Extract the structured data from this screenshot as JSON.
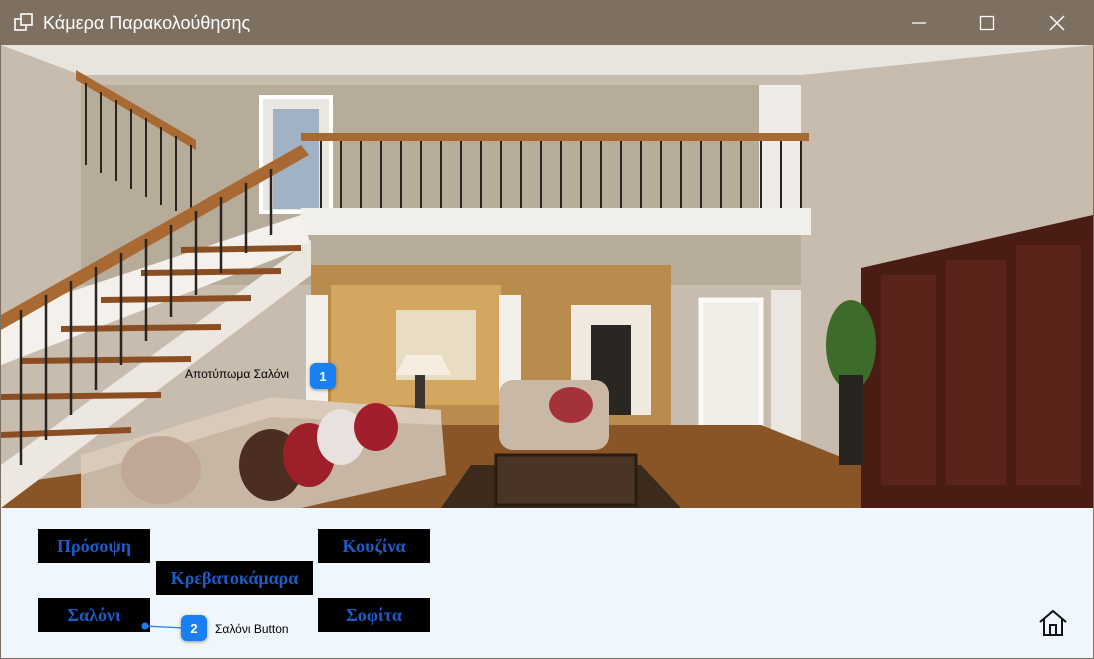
{
  "window": {
    "title": "Κάμερα Παρακολούθησης",
    "titlebar_color": "#7d7060"
  },
  "camera": {
    "image_description_icon": "living-room-camera-feed",
    "annotation": {
      "number": "1",
      "label": "Αποτύπωμα Σαλόνι"
    }
  },
  "rooms": {
    "front": "Πρόσοψη",
    "kitchen": "Κουζίνα",
    "bedroom": "Κρεβατοκάμαρα",
    "living_room": "Σαλόνι",
    "attic": "Σοφίτα"
  },
  "living_room_annotation": {
    "number": "2",
    "label": "Σαλόνι Button"
  },
  "icons": {
    "home": "home-icon"
  },
  "colors": {
    "button_bg": "#000000",
    "button_text": "#1c5cc9",
    "panel_bg": "#eff6fd",
    "callout": "#1a7ff2"
  }
}
